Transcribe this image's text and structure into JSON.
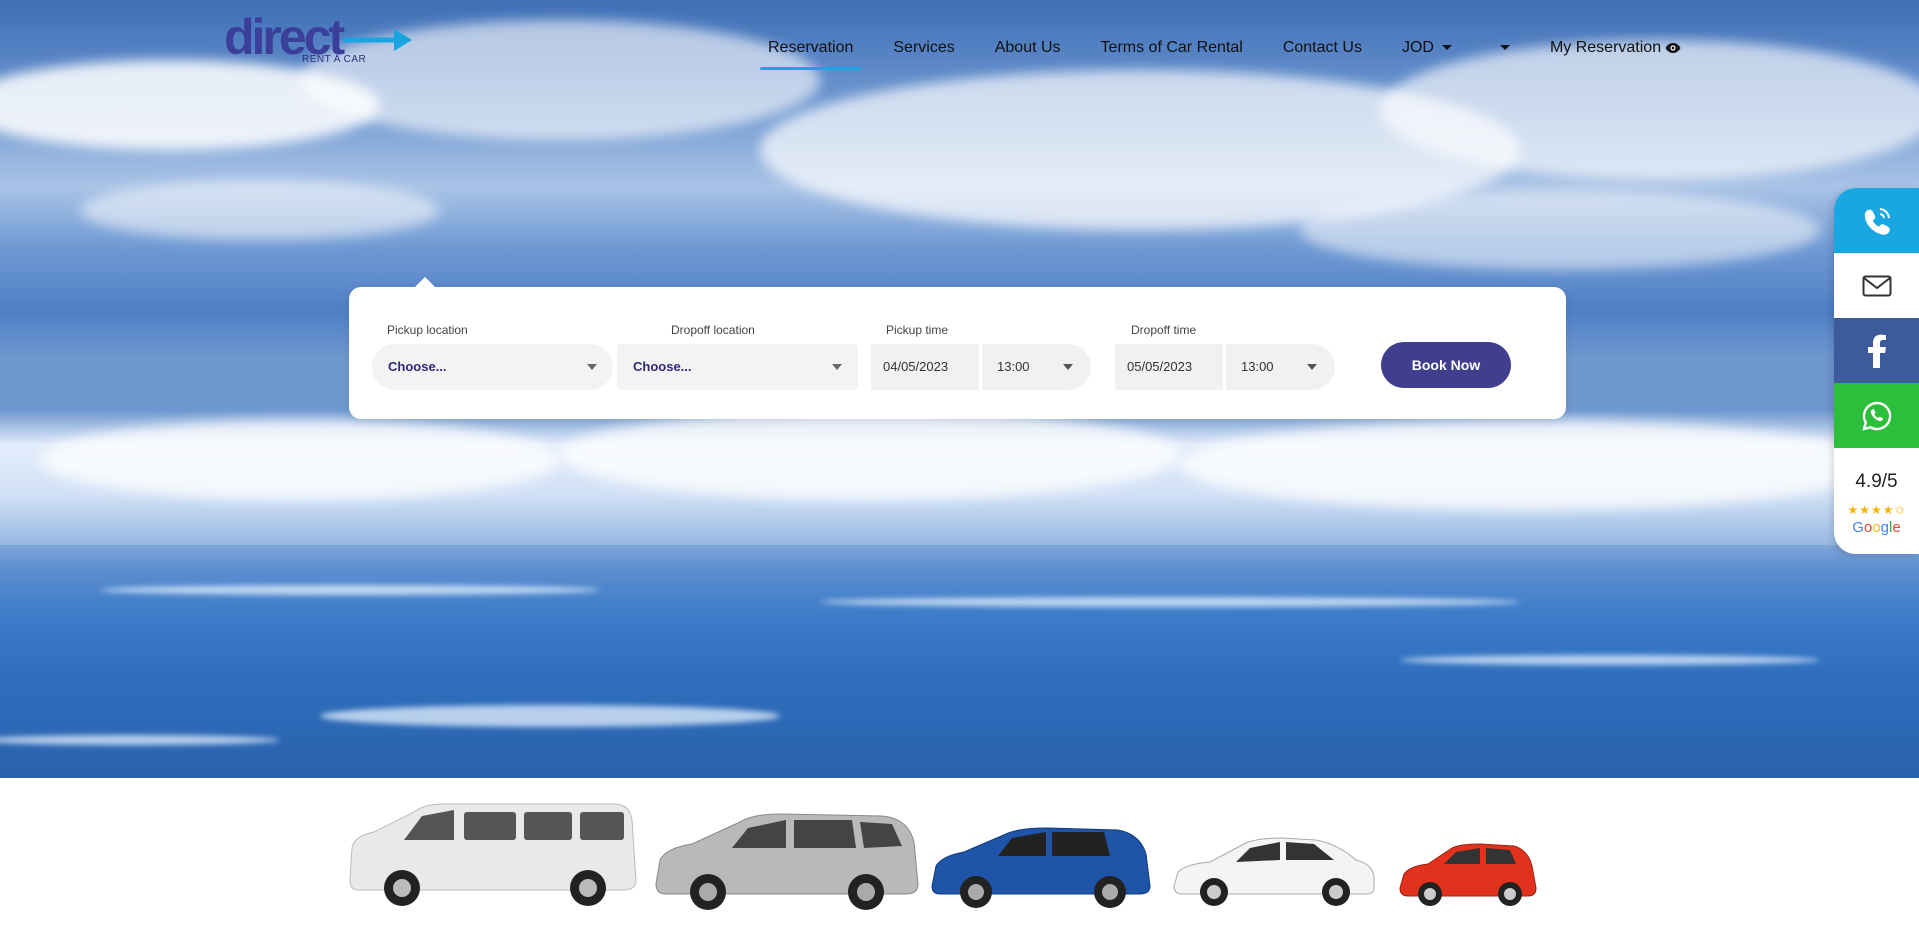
{
  "brand": {
    "name": "direct",
    "tagline": "RENT A CAR"
  },
  "nav": {
    "items": [
      {
        "label": "Reservation",
        "active": true
      },
      {
        "label": "Services"
      },
      {
        "label": "About Us"
      },
      {
        "label": "Terms of Car Rental"
      },
      {
        "label": "Contact Us"
      },
      {
        "label": "JOD"
      },
      {
        "label": ""
      },
      {
        "label": "My Reservation"
      }
    ]
  },
  "booking": {
    "pickup_location_label": "Pickup location",
    "pickup_location_value": "Choose...",
    "dropoff_location_label": "Dropoff location",
    "dropoff_location_value": "Choose...",
    "pickup_time_label": "Pickup time",
    "pickup_date": "04/05/2023",
    "pickup_hour": "13:00",
    "dropoff_time_label": "Dropoff time",
    "dropoff_date": "05/05/2023",
    "dropoff_hour": "13:00",
    "book_button": "Book Now"
  },
  "sidebar": {
    "rating": "4.9/5",
    "stars": "★★★★✩",
    "google_letters": [
      "G",
      "o",
      "o",
      "g",
      "l",
      "e"
    ]
  },
  "colors": {
    "brand": "#3b3f9a",
    "accent": "#19a6e0",
    "book_button": "#403f8f",
    "facebook": "#3d5b9a",
    "whatsapp": "#2bbf3c"
  },
  "icons": [
    "phone-icon",
    "mail-icon",
    "facebook-icon",
    "whatsapp-icon",
    "eye-icon"
  ]
}
